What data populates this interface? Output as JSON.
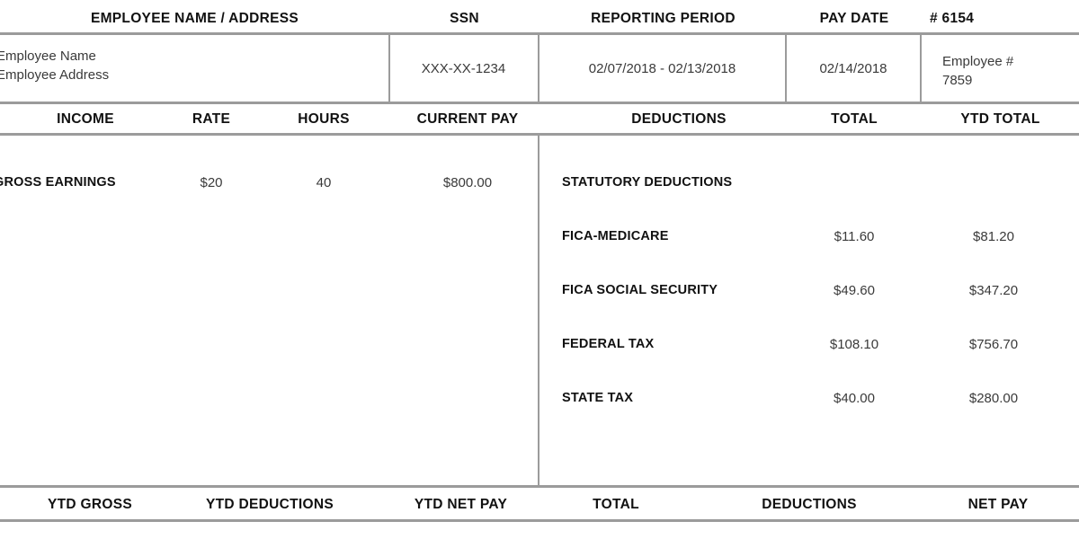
{
  "document": {
    "type": "pay-stub",
    "background": "#ffffff",
    "rule_color": "#9b9b9b",
    "header_text_color": "#111111",
    "value_text_color": "#3a3a3a"
  },
  "top_header": {
    "columns": [
      {
        "label": "EMPLOYEE NAME / ADDRESS"
      },
      {
        "label": "SSN"
      },
      {
        "label": "REPORTING PERIOD"
      },
      {
        "label": "PAY DATE"
      },
      {
        "label": "# 6154"
      }
    ]
  },
  "employee_row": {
    "name": "Employee Name",
    "address": "Employee Address",
    "ssn": "XXX-XX-1234",
    "reporting_period": "02/07/2018 - 02/13/2018",
    "pay_date": "02/14/2018",
    "employee_number_label": "Employee #",
    "employee_number": "7859"
  },
  "income_header": {
    "income": "INCOME",
    "rate": "RATE",
    "hours": "HOURS",
    "current_pay": "CURRENT PAY"
  },
  "deductions_header": {
    "deductions": "DEDUCTIONS",
    "total": "TOTAL",
    "ytd_total": "YTD TOTAL"
  },
  "income_rows": [
    {
      "label": "GROSS EARNINGS",
      "rate": "$20",
      "hours": "40",
      "current_pay": "$800.00"
    }
  ],
  "deduction_section": {
    "title": "STATUTORY DEDUCTIONS",
    "rows": [
      {
        "label": "FICA-MEDICARE",
        "total": "$11.60",
        "ytd_total": "$81.20"
      },
      {
        "label": "FICA SOCIAL SECURITY",
        "total": "$49.60",
        "ytd_total": "$347.20"
      },
      {
        "label": "FEDERAL TAX",
        "total": "$108.10",
        "ytd_total": "$756.70"
      },
      {
        "label": "STATE TAX",
        "total": "$40.00",
        "ytd_total": "$280.00"
      }
    ]
  },
  "footer": {
    "left_columns": [
      {
        "label": "YTD GROSS"
      },
      {
        "label": "YTD DEDUCTIONS"
      },
      {
        "label": "YTD NET PAY"
      }
    ],
    "right_columns": [
      {
        "label": "TOTAL"
      },
      {
        "label": "DEDUCTIONS"
      },
      {
        "label": "NET PAY"
      }
    ]
  }
}
